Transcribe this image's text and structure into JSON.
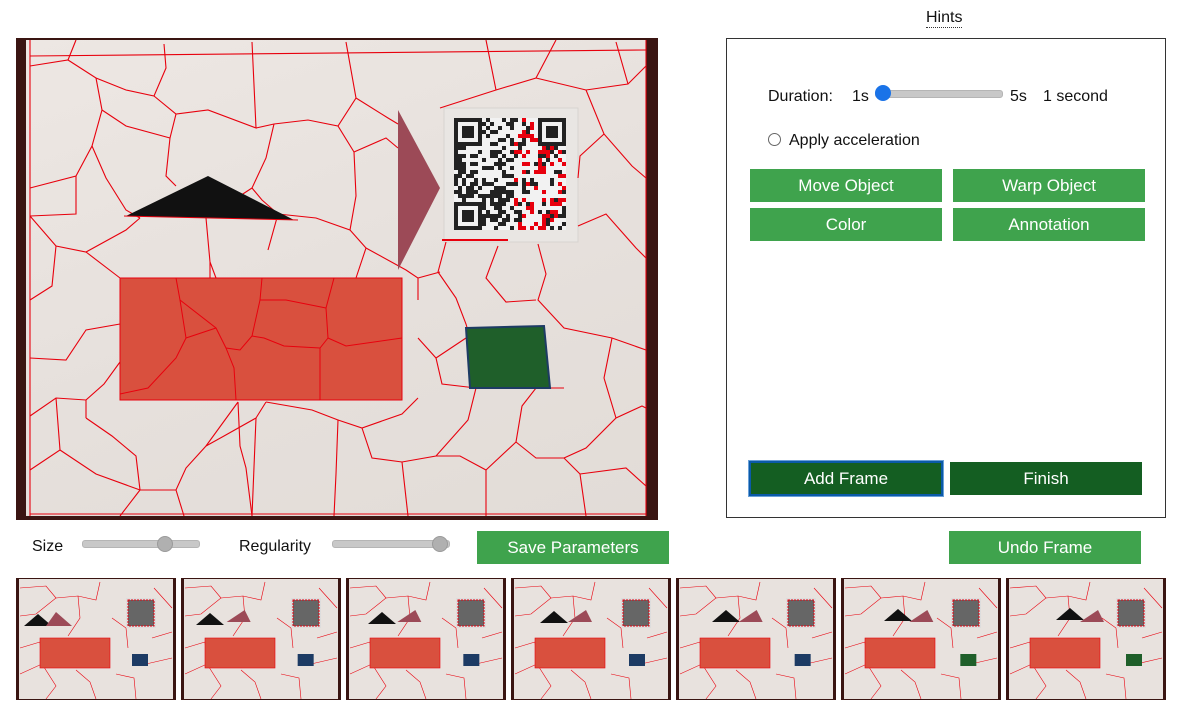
{
  "hints": {
    "label": "Hints"
  },
  "panel": {
    "duration_label": "Duration:",
    "duration_min": "1s",
    "duration_max": "5s",
    "duration_value_text": "1 second",
    "duration_fraction": 0.0,
    "accel_label": "Apply acceleration",
    "accel_checked": false,
    "buttons": {
      "move": "Move Object",
      "warp": "Warp Object",
      "color": "Color",
      "annotation": "Annotation",
      "add_frame": "Add Frame",
      "finish": "Finish"
    }
  },
  "params": {
    "size_label": "Size",
    "size_fraction": 0.72,
    "regularity_label": "Regularity",
    "regularity_fraction": 0.96,
    "save_label": "Save Parameters",
    "undo_label": "Undo Frame"
  },
  "colors": {
    "button_green": "#3fa34d",
    "button_dark_green": "#145e22",
    "slider_blue": "#1a73e8",
    "segment_red": "#e8000d",
    "rectangle_red": "#d9503e",
    "triangle_black": "#111111",
    "triangle_mauve": "#9c4a57",
    "square_green": "#1f5f2a",
    "square_navy": "#1d3b64"
  },
  "filmstrip": {
    "frame_count": 7
  }
}
